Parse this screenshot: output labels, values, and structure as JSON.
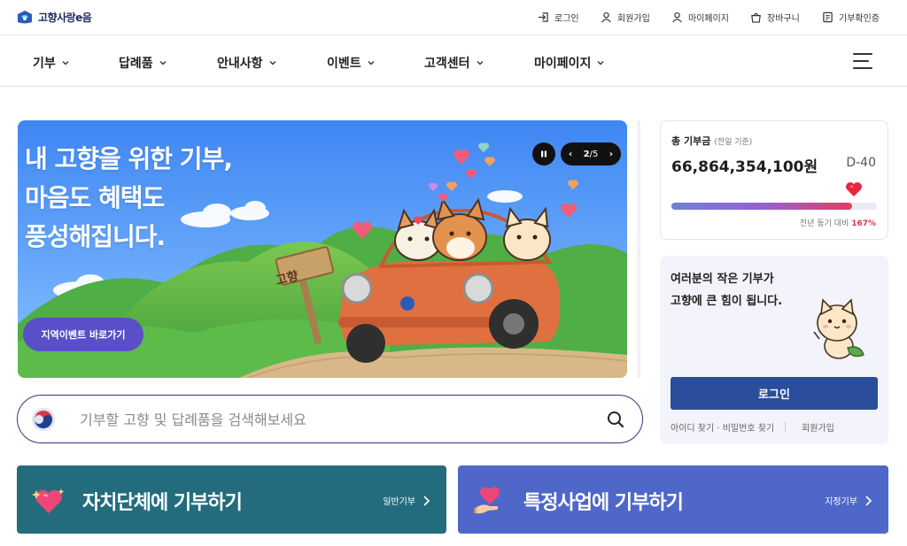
{
  "header": {
    "logo_text": "고향사랑e음",
    "utility": [
      {
        "label": "로그인",
        "icon": "login-icon"
      },
      {
        "label": "회원가입",
        "icon": "user-icon"
      },
      {
        "label": "마이페이지",
        "icon": "user-icon"
      },
      {
        "label": "장바구니",
        "icon": "cart-icon"
      },
      {
        "label": "기부확인증",
        "icon": "certificate-icon"
      }
    ]
  },
  "nav": {
    "items": [
      "기부",
      "답례품",
      "안내사항",
      "이벤트",
      "고객센터",
      "마이페이지"
    ]
  },
  "hero": {
    "title": "내 고향을 위한 기부,\n마음도 혜택도\n풍성해집니다.",
    "signpost": "고향",
    "cta": "지역이벤트 바로가기",
    "pager_current": "2",
    "pager_total": "/5"
  },
  "search": {
    "placeholder": "기부할 고향 및 답례품을 검색해보세요"
  },
  "cards": [
    {
      "title": "자치단체에 기부하기",
      "sub": "일반기부"
    },
    {
      "title": "특정사업에 기부하기",
      "sub": "지정기부"
    }
  ],
  "total": {
    "label": "총 기부금",
    "note": "(전일 기준)",
    "amount": "66,864,354,100원",
    "dday": "D-40",
    "compare_label": "전년 동기 대비",
    "compare_value": "167%",
    "progress_fraction": 0.88
  },
  "login": {
    "message": "여러분의 작은 기부가\n고향에 큰 힘이 됩니다.",
    "button": "로그인",
    "find_links": "아이디 찾기 · 비밀번호 찾기",
    "signup": "회원가입"
  },
  "colors": {
    "brand_navy": "#2a4d9c",
    "card_teal": "#236c7e",
    "card_blue": "#4f67c9",
    "accent_red": "#d63a4b"
  }
}
